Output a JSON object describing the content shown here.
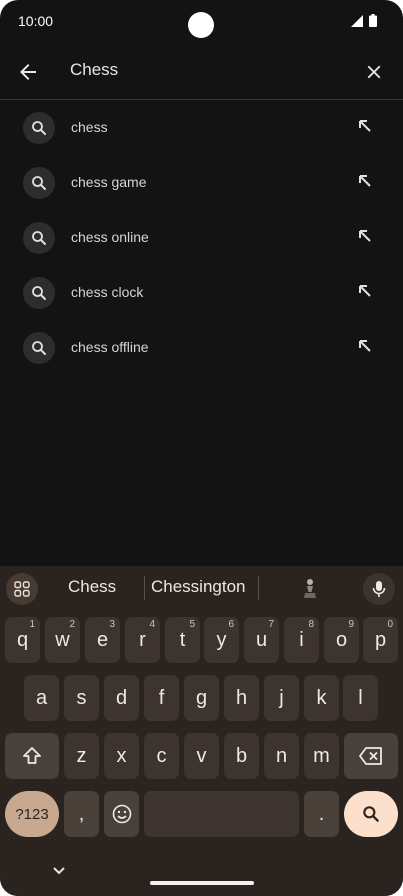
{
  "status": {
    "time": "10:00"
  },
  "search": {
    "query": "Chess",
    "suggestions": [
      "chess",
      "chess game",
      "chess online",
      "chess clock",
      "chess offline"
    ]
  },
  "keyboard": {
    "suggestions": [
      "Chess",
      "Chessington"
    ],
    "row1": [
      "q",
      "w",
      "e",
      "r",
      "t",
      "y",
      "u",
      "i",
      "o",
      "p"
    ],
    "row1_nums": [
      "1",
      "2",
      "3",
      "4",
      "5",
      "6",
      "7",
      "8",
      "9",
      "0"
    ],
    "row2": [
      "a",
      "s",
      "d",
      "f",
      "g",
      "h",
      "j",
      "k",
      "l"
    ],
    "row3": [
      "z",
      "x",
      "c",
      "v",
      "b",
      "n",
      "m"
    ],
    "symbols_label": "?123",
    "comma": ",",
    "period": "."
  },
  "colors": {
    "background": "#131313",
    "keyboard": "#2a231f",
    "key": "#3d3430",
    "accent": "#fde0cc"
  }
}
